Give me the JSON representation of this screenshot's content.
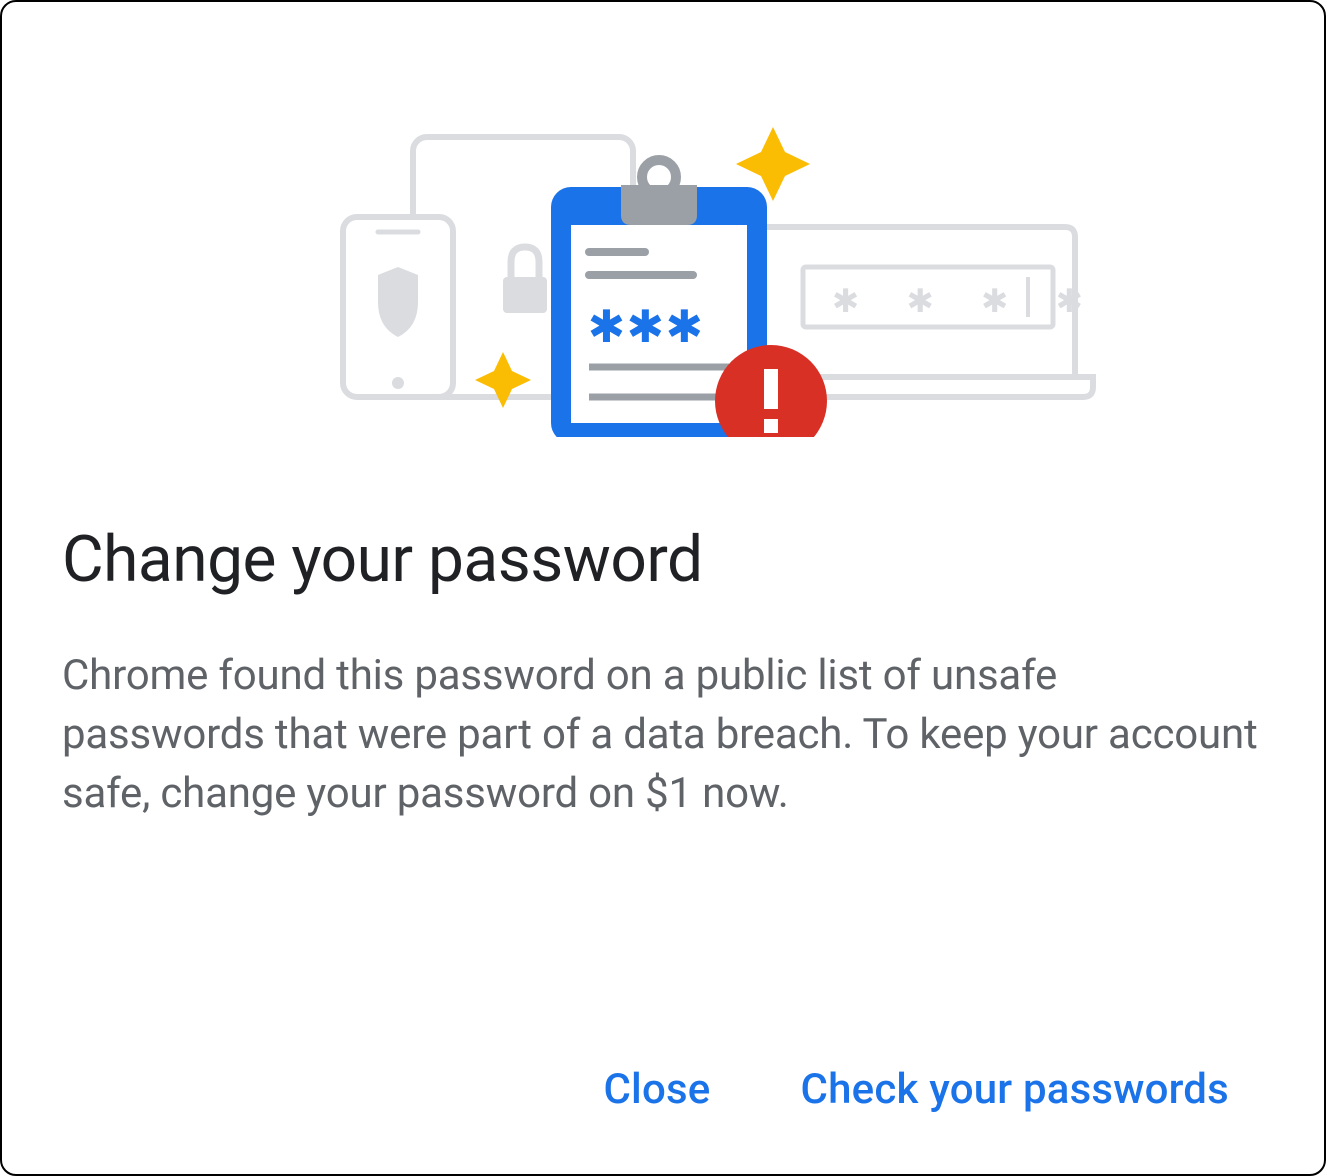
{
  "dialog": {
    "title": "Change your password",
    "body": "Chrome found this password on a public list of unsafe passwords that were part of a data breach. To keep your account safe, change your password on $1 now.",
    "actions": {
      "close": "Close",
      "check": "Check your passwords"
    }
  }
}
